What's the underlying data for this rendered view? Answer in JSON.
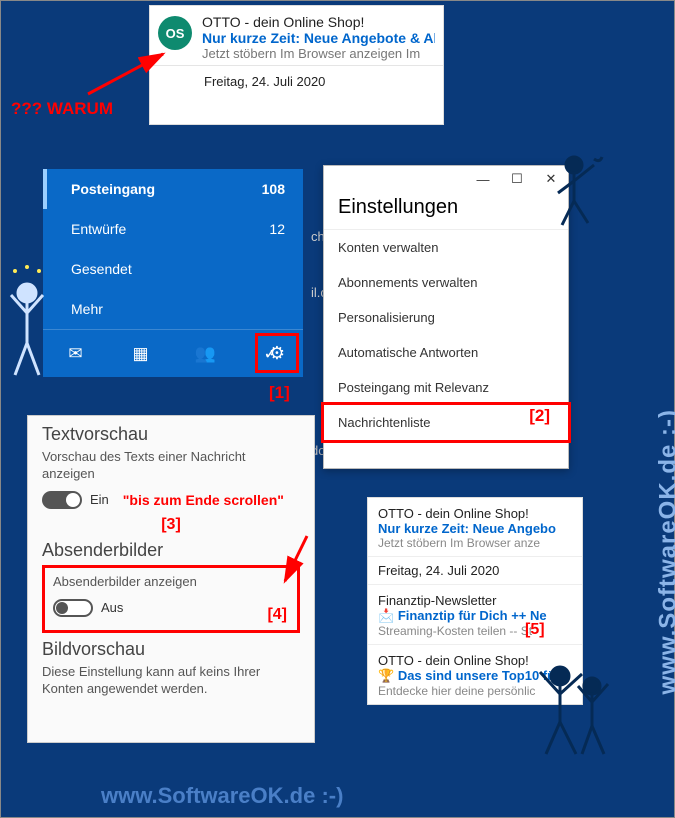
{
  "annotations": {
    "warum": "??? WARUM",
    "label1": "[1]",
    "label2": "[2]",
    "hint3": "\"bis zum Ende scrollen\"",
    "label3": "[3]",
    "label4": "[4]",
    "label5": "[5]"
  },
  "mail_preview": {
    "avatar_initials": "OS",
    "avatar_color": "#0e8a6f",
    "sender": "OTTO - dein Online Shop!",
    "subject": "Nur kurze Zeit: Neue Angebote & Ak",
    "snippet": "Jetzt stöbern Im Browser anzeigen Im",
    "date": "Freitag, 24. Juli 2020"
  },
  "folders": {
    "items": [
      {
        "label": "Posteingang",
        "count": "108",
        "bold": true
      },
      {
        "label": "Entwürfe",
        "count": "12",
        "bold": false
      },
      {
        "label": "Gesendet",
        "count": "",
        "bold": false
      },
      {
        "label": "Mehr",
        "count": "",
        "bold": false
      }
    ],
    "icons": {
      "mail": "✉",
      "calendar": "▦",
      "people": "👥",
      "todo": "✓",
      "settings": "⚙"
    }
  },
  "settings_flyout": {
    "win_minimize": "—",
    "win_maximize": "☐",
    "win_close": "✕",
    "title": "Einstellungen",
    "options": [
      "Konten verwalten",
      "Abonnements verwalten",
      "Personalisierung",
      "Automatische Antworten",
      "Posteingang mit Relevanz",
      "Nachrichtenliste"
    ],
    "ghost_behind": {
      "schrift": "chrift",
      "mail": "il.com",
      "dows": "dows"
    }
  },
  "options_panel": {
    "sec1_title": "Textvorschau",
    "sec1_sub": "Vorschau des Texts einer Nachricht anzeigen",
    "sec1_state": "Ein",
    "sec2_title": "Absenderbilder",
    "sec2_sub": "Absenderbilder anzeigen",
    "sec2_state": "Aus",
    "sec3_title": "Bildvorschau",
    "sec3_sub": "Diese Einstellung kann auf keins Ihrer Konten angewendet werden."
  },
  "mail_list": {
    "items": [
      {
        "sender": "OTTO - dein Online Shop!",
        "subject": "Nur kurze Zeit: Neue Angebo",
        "snippet": "Jetzt stöbern Im Browser anze"
      }
    ],
    "date": "Freitag, 24. Juli 2020",
    "items2": [
      {
        "sender": "Finanztip-Newsletter",
        "subject_emoji": "📩",
        "subject": "Finanztip für Dich ++ Ne",
        "snippet": "Streaming-Kosten teilen -- St"
      },
      {
        "sender": "OTTO - dein Online Shop!",
        "subject_emoji": "🏆",
        "subject": "Das sind unsere Top10 fü",
        "snippet": "Entdecke hier deine persönlic"
      }
    ]
  },
  "watermark": {
    "text": "www.SoftwareOK.de :-)"
  }
}
